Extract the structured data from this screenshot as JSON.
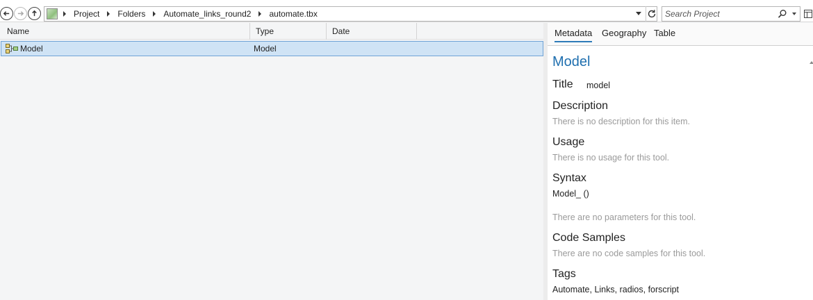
{
  "nav": {
    "breadcrumbs": [
      "Project",
      "Folders",
      "Automate_links_round2",
      "automate.tbx"
    ],
    "search_placeholder": "Search Project"
  },
  "columns": [
    "Name",
    "Type",
    "Date"
  ],
  "rows": [
    {
      "name": "Model",
      "type": "Model",
      "date": ""
    }
  ],
  "tabs": [
    "Metadata",
    "Geography",
    "Table"
  ],
  "metadata": {
    "item_title": "Model",
    "title_label": "Title",
    "title_value": "model",
    "description_label": "Description",
    "description_value": "There is no description for this item.",
    "usage_label": "Usage",
    "usage_value": "There is no usage for this tool.",
    "syntax_label": "Syntax",
    "syntax_value": "Model_ ()",
    "parameters_value": "There are no parameters for this tool.",
    "code_samples_label": "Code Samples",
    "code_samples_value": "There are no code samples for this tool.",
    "tags_label": "Tags",
    "tags_value": "Automate, Links, radios, forscript"
  },
  "colors": {
    "accent": "#1f6faf",
    "selection": "#cfe3f5",
    "muted_text": "#9a9a9a"
  }
}
